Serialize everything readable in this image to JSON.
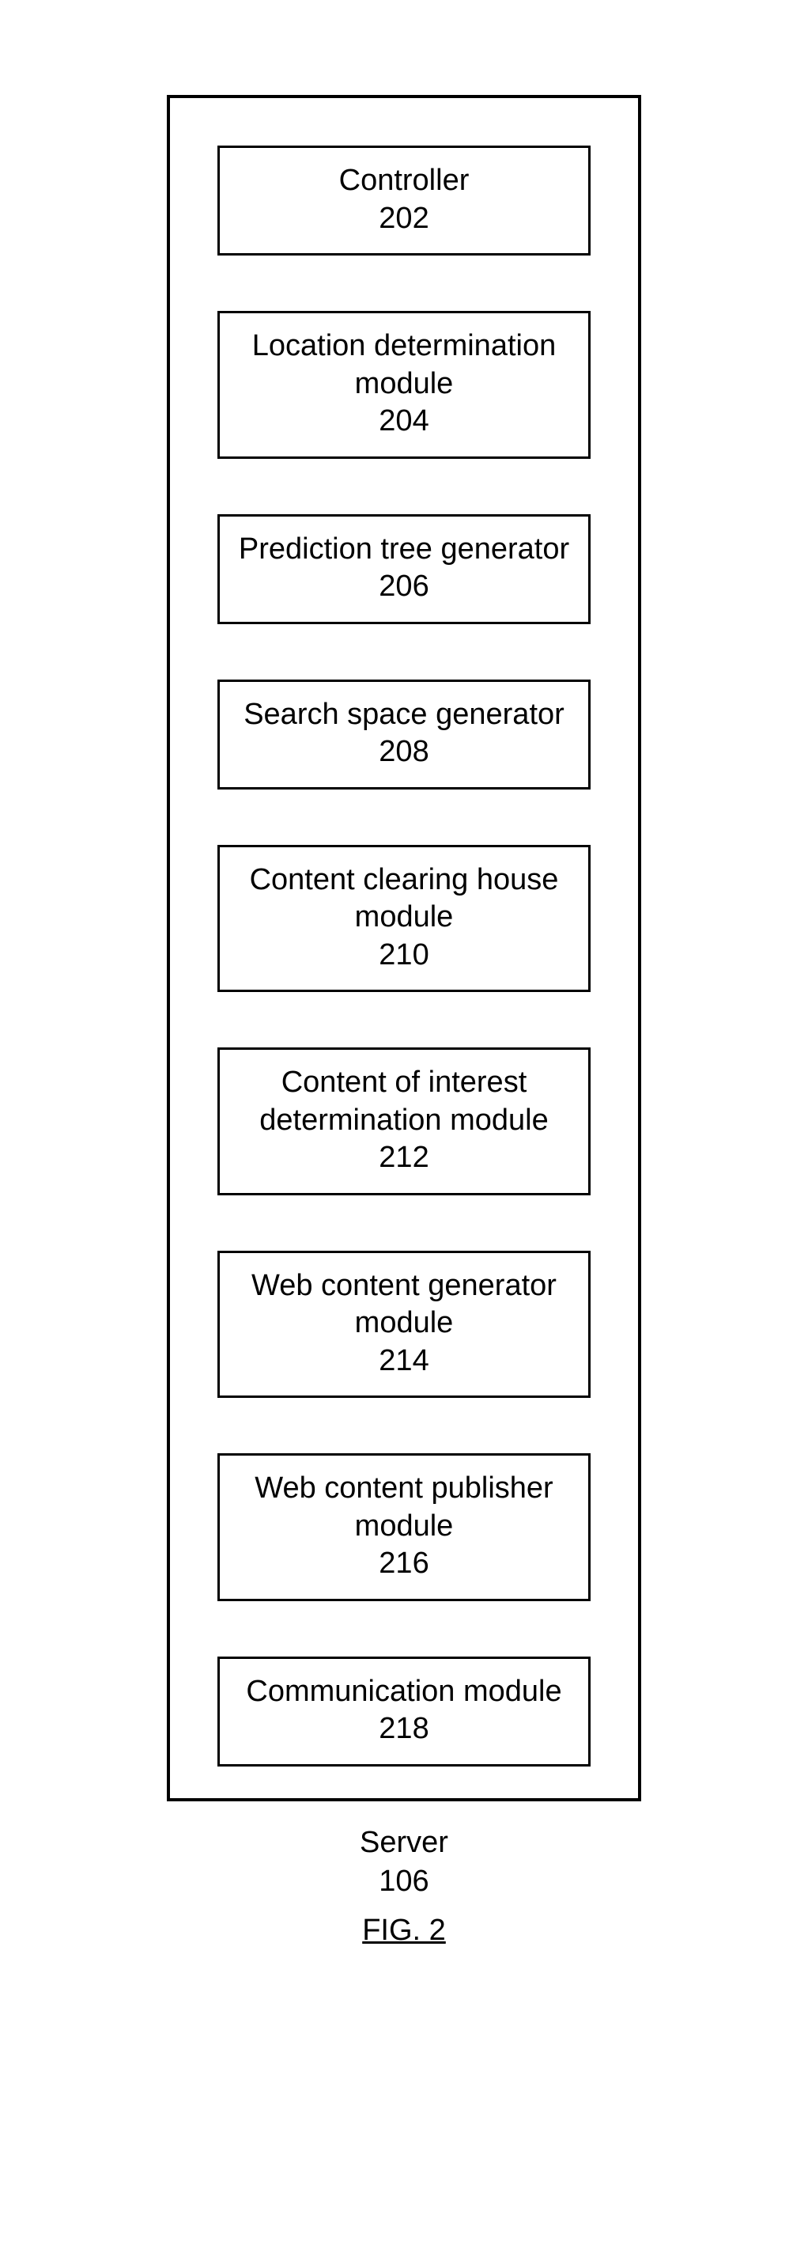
{
  "modules": [
    {
      "label": "Controller",
      "num": "202"
    },
    {
      "label": "Location determination module",
      "num": "204"
    },
    {
      "label": "Prediction tree generator",
      "num": "206"
    },
    {
      "label": "Search space generator",
      "num": "208"
    },
    {
      "label": "Content clearing house module",
      "num": "210"
    },
    {
      "label": "Content of interest determination module",
      "num": "212"
    },
    {
      "label": "Web content generator module",
      "num": "214"
    },
    {
      "label": "Web content publisher module",
      "num": "216"
    },
    {
      "label": "Communication module",
      "num": "218"
    }
  ],
  "caption_label": "Server",
  "caption_num": "106",
  "figure_label": "FIG. 2"
}
